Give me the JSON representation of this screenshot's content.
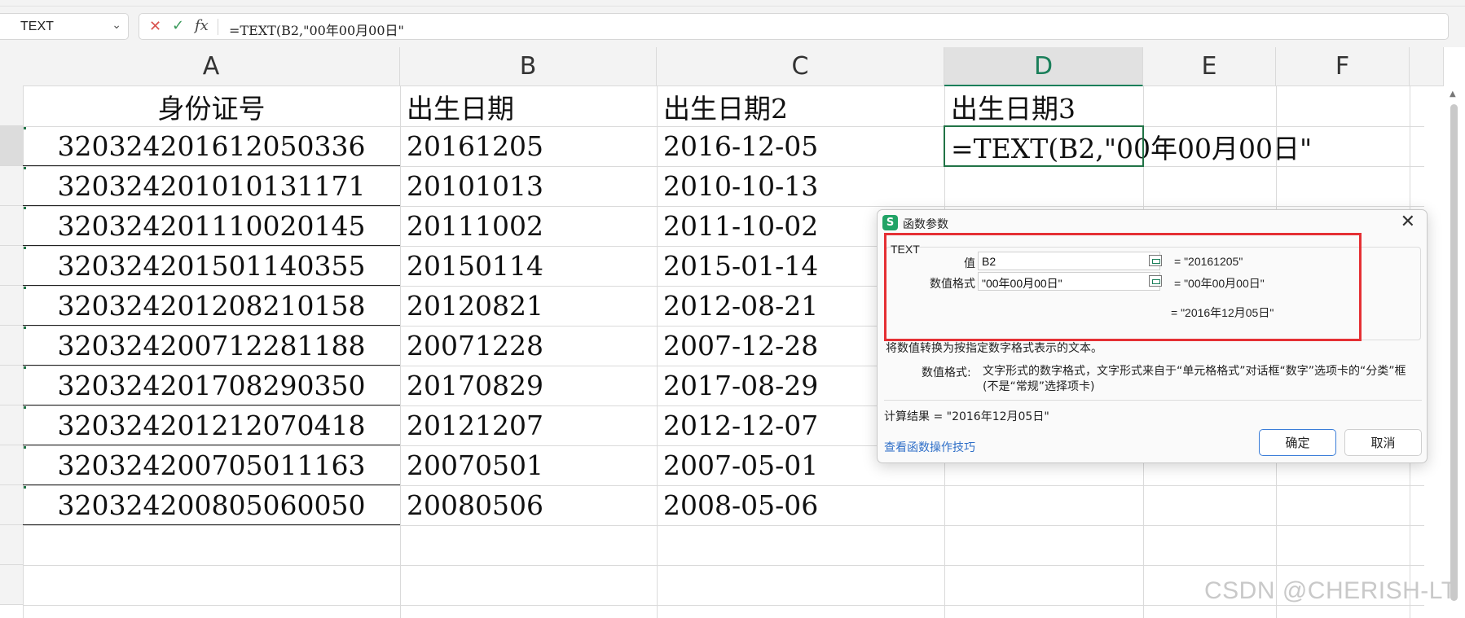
{
  "formula_bar": {
    "name_box": "TEXT",
    "formula": "=TEXT(B2,\"00年00月00日\""
  },
  "columns": [
    "A",
    "B",
    "C",
    "D",
    "E",
    "F"
  ],
  "active_column": "D",
  "rows": [
    {
      "id": "身份证号",
      "birth": "出生日期",
      "birth2": "出生日期2",
      "birth3": "出生日期3"
    },
    {
      "id": "320324201612050336",
      "birth": "20161205",
      "birth2": "2016-12-05",
      "birth3": "=TEXT(B2,\"00年00月00日\""
    },
    {
      "id": "320324201010131171",
      "birth": "20101013",
      "birth2": "2010-10-13",
      "birth3": ""
    },
    {
      "id": "320324201110020145",
      "birth": "20111002",
      "birth2": "2011-10-02",
      "birth3": ""
    },
    {
      "id": "320324201501140355",
      "birth": "20150114",
      "birth2": "2015-01-14",
      "birth3": ""
    },
    {
      "id": "320324201208210158",
      "birth": "20120821",
      "birth2": "2012-08-21",
      "birth3": ""
    },
    {
      "id": "320324200712281188",
      "birth": "20071228",
      "birth2": "2007-12-28",
      "birth3": ""
    },
    {
      "id": "320324201708290350",
      "birth": "20170829",
      "birth2": "2017-08-29",
      "birth3": ""
    },
    {
      "id": "320324201212070418",
      "birth": "20121207",
      "birth2": "2012-12-07",
      "birth3": ""
    },
    {
      "id": "320324200705011163",
      "birth": "20070501",
      "birth2": "2007-05-01",
      "birth3": ""
    },
    {
      "id": "320324200805060050",
      "birth": "20080506",
      "birth2": "2008-05-06",
      "birth3": ""
    }
  ],
  "dialog": {
    "title": "函数参数",
    "app_icon": "S",
    "function_name": "TEXT",
    "args": [
      {
        "label": "值",
        "value": "B2",
        "result": "= \"20161205\""
      },
      {
        "label": "数值格式",
        "value": "\"00年00月00日\"",
        "result": "= \"00年00月00日\""
      }
    ],
    "overall_result": "= \"2016年12月05日\"",
    "description": "将数值转换为按指定数字格式表示的文本。",
    "arg_help_label": "数值格式:",
    "arg_help_text": "文字形式的数字格式，文字形式来自于“单元格格式”对话框“数字”选项卡的“分类”框(不是“常规”选择项卡)",
    "calc_result": "计算结果 = \"2016年12月05日\"",
    "help_link": "查看函数操作技巧",
    "ok_label": "确定",
    "cancel_label": "取消"
  },
  "watermark": "CSDN @CHERISH-LT",
  "colors": {
    "accent_green": "#217346",
    "highlight_red": "#e53034",
    "link_blue": "#2f6fc8"
  }
}
